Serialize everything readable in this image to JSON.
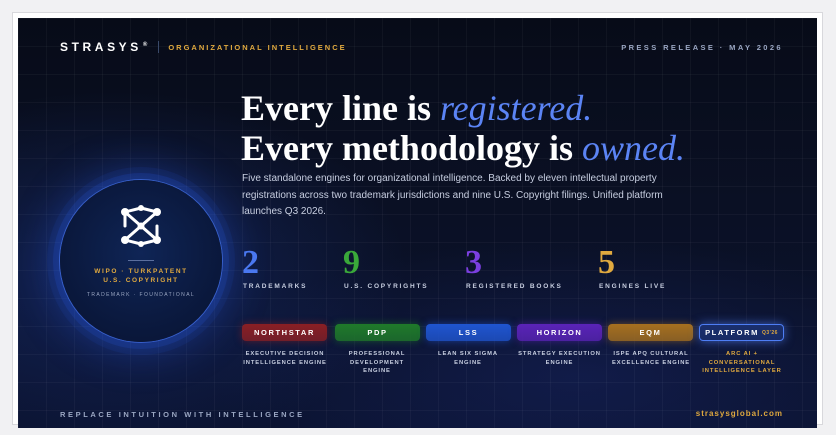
{
  "brand": {
    "name": "STRASYS",
    "mark": "®",
    "tagline": "ORGANIZATIONAL INTELLIGENCE"
  },
  "press": "PRESS RELEASE · MAY 2026",
  "headline": {
    "line1_prefix": "Every line is ",
    "line1_em": "registered.",
    "line2_prefix": "Every methodology is ",
    "line2_em": "owned."
  },
  "description": "Five standalone engines for organizational intelligence. Backed by eleven intellectual property registrations across two trademark jurisdictions and nine U.S. Copyright filings. Unified platform launches Q3 2026.",
  "badge": {
    "line1": "WIPO · TURKPATENT",
    "line2": "U.S. COPYRIGHT",
    "line3": "TRADEMARK · FOUNDATIONAL",
    "icon": "network-nodes-icon"
  },
  "stats": [
    {
      "value": "2",
      "label": "TRADEMARKS",
      "color": "#4a78f0"
    },
    {
      "value": "9",
      "label": "U.S. COPYRIGHTS",
      "color": "#3aa83a"
    },
    {
      "value": "3",
      "label": "REGISTERED BOOKS",
      "color": "#7b3fe0"
    },
    {
      "value": "5",
      "label": "ENGINES LIVE",
      "color": "#e0a93f"
    }
  ],
  "engines": [
    {
      "name": "NORTHSTAR",
      "desc": "EXECUTIVE DECISION INTELLIGENCE ENGINE",
      "color": "#8a1f24"
    },
    {
      "name": "PDP",
      "desc": "PROFESSIONAL DEVELOPMENT ENGINE",
      "color": "#1f7a2a"
    },
    {
      "name": "LSS",
      "desc": "LEAN SIX SIGMA ENGINE",
      "color": "#1f55d0"
    },
    {
      "name": "HORIZON",
      "desc": "STRATEGY EXECUTION ENGINE",
      "color": "#5a23b8"
    },
    {
      "name": "EQM",
      "desc": "ISPE APQ CULTURAL EXCELLENCE ENGINE",
      "color": "#a6701f"
    },
    {
      "name": "PLATFORM",
      "sup": "Q3'26",
      "desc": "ARC AI + CONVERSATIONAL INTELLIGENCE LAYER",
      "color": "#1a2f6e"
    }
  ],
  "footer": {
    "left": "REPLACE INTUITION WITH INTELLIGENCE",
    "right": "strasysglobal.com"
  },
  "colors": {
    "accent_gold": "#e0a93f",
    "accent_blue": "#5b84f5",
    "background": "#0a1024"
  }
}
